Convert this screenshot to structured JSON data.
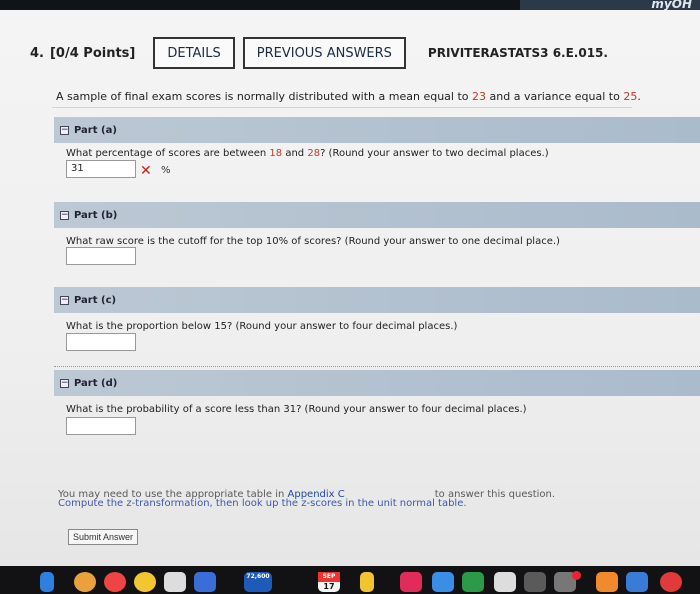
{
  "topbar": {
    "logo_text": "myOH"
  },
  "question": {
    "number": "4.",
    "points": "[0/4 Points]",
    "details_label": "DETAILS",
    "previous_answers_label": "PREVIOUS ANSWERS",
    "source_id": "PRIVITERASTATS3 6.E.015."
  },
  "problem": {
    "text_before_mean": "A sample of final exam scores is normally distributed with a mean equal to ",
    "mean": "23",
    "text_before_variance": " and a variance equal to ",
    "variance": "25",
    "text_end": "."
  },
  "parts": [
    {
      "label": "Part (a)",
      "question_before": "What percentage of scores are between ",
      "value_1": "18",
      "question_middle": " and ",
      "value_2": "28",
      "question_after": "? (Round your answer to two decimal places.)",
      "answer_value": "31",
      "status": "incorrect",
      "unit": "%"
    },
    {
      "label": "Part (b)",
      "question": "What raw score is the cutoff for the top 10% of scores? (Round your answer to one decimal place.)",
      "answer_value": ""
    },
    {
      "label": "Part (c)",
      "question": "What is the proportion below 15? (Round your answer to four decimal places.)",
      "answer_value": ""
    },
    {
      "label": "Part (d)",
      "question": "What is the probability of a score less than 31? (Round your answer to four decimal places.)",
      "answer_value": ""
    }
  ],
  "footer": {
    "note_before": "You may need to use the appropriate table in ",
    "appendix_link": "Appendix C",
    "note_after": "to answer this question.",
    "compute_instruction": "Compute the z-transformation, then look up the z-scores in the unit normal table.",
    "submit_label": "Submit Answer"
  },
  "dock": {
    "tv_badge": "72,600",
    "calendar_month": "SEP",
    "calendar_day": "17"
  },
  "colors": {
    "highlight_red": "#c0392b",
    "incorrect_x": "#c81c1c",
    "part_bar": "#b4c3d2",
    "link_blue": "#1f4aa0"
  }
}
